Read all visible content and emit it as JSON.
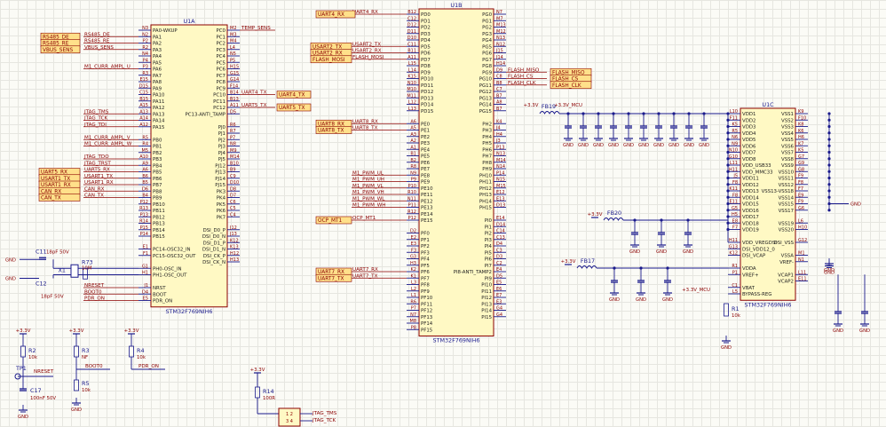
{
  "sheet": {
    "accent": "#1a1a8c",
    "wire": "#1a1a8c",
    "body_fill": "#fff9c4",
    "label": "#8b0000",
    "port_fill": "#ffe08a"
  },
  "u1a": {
    "ref": "U1A",
    "part": "STM32F769NIH6",
    "left": [
      [
        "PA0-WKUP",
        "N3"
      ],
      [
        "PA1",
        "N2"
      ],
      [
        "PA2",
        "P2"
      ],
      [
        "PA3",
        "R2"
      ],
      [
        "PA4",
        "N4"
      ],
      [
        "PA5",
        "P4"
      ],
      [
        "PA6",
        "P3"
      ],
      [
        "PA7",
        "R3"
      ],
      [
        "PA8",
        "E15"
      ],
      [
        "PA9",
        "D15"
      ],
      [
        "PA10",
        "C15"
      ],
      [
        "PA11",
        "B15"
      ],
      [
        "PA12",
        "A15"
      ],
      [
        "PA13",
        "A13"
      ],
      [
        "PA14",
        "A14"
      ],
      [
        "PA15",
        "A12"
      ],
      [
        "PB0",
        "R5"
      ],
      [
        "PB1",
        "R4"
      ],
      [
        "PB2",
        "M5"
      ],
      [
        "PB3",
        "A10"
      ],
      [
        "PB4",
        "A9"
      ],
      [
        "PB5",
        "A6"
      ],
      [
        "PB6",
        "B6"
      ],
      [
        "PB7",
        "B5"
      ],
      [
        "PB8",
        "D6"
      ],
      [
        "PB9",
        "B4"
      ],
      [
        "PB10",
        "P12"
      ],
      [
        "PB11",
        "R13"
      ],
      [
        "PB12",
        "P13"
      ],
      [
        "PB13",
        "R14"
      ],
      [
        "PB14",
        "P15"
      ],
      [
        "PB15",
        "P14"
      ],
      [
        "PC14-OSC32_IN",
        "E1"
      ],
      [
        "PC15-OSC32_OUT",
        "F1"
      ],
      [
        "PH0-OSC_IN",
        "G1"
      ],
      [
        "PH1-OSC_OUT",
        "H1"
      ],
      [
        "NRST",
        "J1"
      ],
      [
        "BOOT",
        "D4"
      ],
      [
        "PDR_ON",
        "E5"
      ]
    ],
    "right": [
      [
        "PC0",
        "M2"
      ],
      [
        "PC1",
        "M3"
      ],
      [
        "PC2",
        "M4"
      ],
      [
        "PC3",
        "L4"
      ],
      [
        "PC4",
        "N5"
      ],
      [
        "PC5",
        "P5"
      ],
      [
        "PC6",
        "H15"
      ],
      [
        "PC7",
        "G15"
      ],
      [
        "PC8",
        "G14"
      ],
      [
        "PC9",
        "F14"
      ],
      [
        "PC10",
        "B14"
      ],
      [
        "PC11",
        "B13"
      ],
      [
        "PC12",
        "A11"
      ],
      [
        "PC13-ANTI_TAMP",
        "D5"
      ],
      [
        "PJ0",
        "R6"
      ],
      [
        "PJ1",
        "R7"
      ],
      [
        "PJ2",
        "P7"
      ],
      [
        "PJ3",
        "N8"
      ],
      [
        "PJ4",
        "M9"
      ],
      [
        "PJ5",
        "M14"
      ],
      [
        "PJ12",
        "B10"
      ],
      [
        "PJ13",
        "B9"
      ],
      [
        "PJ14",
        "C9"
      ],
      [
        "PJ15",
        "D10"
      ],
      [
        "PK3",
        "D8"
      ],
      [
        "PK4",
        "D7"
      ],
      [
        "PK5",
        "C6"
      ],
      [
        "PK6",
        "C5"
      ],
      [
        "PK7",
        "C4"
      ],
      [
        "DSI_D0_P",
        "J12"
      ],
      [
        "DSI_D0_N",
        "J13"
      ],
      [
        "DSI_D1_P",
        "K12"
      ],
      [
        "DSI_D1_N",
        "K13"
      ],
      [
        "DSI_CK_P",
        "H12"
      ],
      [
        "DSI_CK_N",
        "H13"
      ]
    ],
    "nets_left": [
      [
        "RS485_DE",
        "PA1"
      ],
      [
        "RS485_RE",
        "PA2"
      ],
      [
        "VBUS_SENS",
        "PA3"
      ],
      [
        "M1_CURR_AMPL_U",
        "PA6"
      ],
      [
        "JTAG_TMS",
        "PA13"
      ],
      [
        "JTAG_TCK",
        "PA14"
      ],
      [
        "JTAG_TDI",
        "PA15"
      ],
      [
        "M1_CURR_AMPL_V",
        "PB0"
      ],
      [
        "M1_CURR_AMPL_W",
        "PB1"
      ],
      [
        "JTAG_TDO",
        "PB3"
      ],
      [
        "JTAG_TRST",
        "PB4"
      ],
      [
        "UART5_RX",
        "PB5"
      ],
      [
        "USART1_TX",
        "PB6"
      ],
      [
        "USART1_RX",
        "PB7"
      ],
      [
        "CAN_RX",
        "PB8"
      ],
      [
        "CAN_TX",
        "PB9"
      ],
      [
        "NRESET",
        "NRST"
      ],
      [
        "BOOT0",
        "BOOT"
      ],
      [
        "PDR_ON",
        "PDR_ON"
      ]
    ],
    "nets_right": [
      [
        "TEMP_SENS",
        "PC0"
      ],
      [
        "UART4_TX",
        "PC10"
      ],
      [
        "UART5_TX",
        "PC12"
      ]
    ]
  },
  "u1b": {
    "ref": "U1B",
    "part": "STM32F769NIH6",
    "left": [
      [
        "PD0",
        "B12"
      ],
      [
        "PD1",
        "C12"
      ],
      [
        "PD2",
        "D12"
      ],
      [
        "PD3",
        "D11"
      ],
      [
        "PD4",
        "D10"
      ],
      [
        "PD5",
        "C11"
      ],
      [
        "PD6",
        "B11"
      ],
      [
        "PD7",
        "A11"
      ],
      [
        "PD8",
        "L15"
      ],
      [
        "PD9",
        "L14"
      ],
      [
        "PD10",
        "K15"
      ],
      [
        "PD11",
        "N10"
      ],
      [
        "PD12",
        "M10"
      ],
      [
        "PD13",
        "M11"
      ],
      [
        "PD14",
        "L12"
      ],
      [
        "PD15",
        "L13"
      ],
      [
        "PE0",
        "A6"
      ],
      [
        "PE1",
        "A5"
      ],
      [
        "PE2",
        "A3"
      ],
      [
        "PE3",
        "A2"
      ],
      [
        "PE4",
        "A1"
      ],
      [
        "PE5",
        "B1"
      ],
      [
        "PE6",
        "B2"
      ],
      [
        "PE7",
        "R8"
      ],
      [
        "PE8",
        "N9"
      ],
      [
        "PE9",
        "P9"
      ],
      [
        "PE10",
        "P10"
      ],
      [
        "PE11",
        "R10"
      ],
      [
        "PE12",
        "N11"
      ],
      [
        "PE13",
        "P11"
      ],
      [
        "PE14",
        "R12"
      ],
      [
        "PE15",
        "P12"
      ],
      [
        "PF0",
        "D2"
      ],
      [
        "PF1",
        "E2"
      ],
      [
        "PF2",
        "E3"
      ],
      [
        "PF3",
        "F3"
      ],
      [
        "PF4",
        "G3"
      ],
      [
        "PF5",
        "H3"
      ],
      [
        "PF6",
        "K2"
      ],
      [
        "PF7",
        "K1"
      ],
      [
        "PF8",
        "L3"
      ],
      [
        "PF9",
        "L2"
      ],
      [
        "PF10",
        "L1"
      ],
      [
        "PF11",
        "R6"
      ],
      [
        "PF12",
        "P7"
      ],
      [
        "PF13",
        "N7"
      ],
      [
        "PF14",
        "M8"
      ],
      [
        "PF15",
        "P8"
      ]
    ],
    "right": [
      [
        "PG0",
        "N7"
      ],
      [
        "PG1",
        "M7"
      ],
      [
        "PG2",
        "M13"
      ],
      [
        "PG3",
        "M12"
      ],
      [
        "PG4",
        "N13"
      ],
      [
        "PG5",
        "N12"
      ],
      [
        "PG6",
        "J15"
      ],
      [
        "PG7",
        "J14"
      ],
      [
        "PG8",
        "H14"
      ],
      [
        "PG9",
        "D9"
      ],
      [
        "PG10",
        "C8"
      ],
      [
        "PG11",
        "B8"
      ],
      [
        "PG12",
        "C7"
      ],
      [
        "PG13",
        "B7"
      ],
      [
        "PG14",
        "A8"
      ],
      [
        "PG15",
        "B7"
      ],
      [
        "PH2",
        "K4"
      ],
      [
        "PH3",
        "J4"
      ],
      [
        "PH4",
        "H4"
      ],
      [
        "PH5",
        "J3"
      ],
      [
        "PH6",
        "P13"
      ],
      [
        "PH7",
        "N13"
      ],
      [
        "PH8",
        "M14"
      ],
      [
        "PH9",
        "N14"
      ],
      [
        "PH10",
        "P14"
      ],
      [
        "PH11",
        "N15"
      ],
      [
        "PH12",
        "M15"
      ],
      [
        "PH13",
        "E12"
      ],
      [
        "PH14",
        "E13"
      ],
      [
        "PH15",
        "D13"
      ],
      [
        "PI0",
        "E14"
      ],
      [
        "PI1",
        "D14"
      ],
      [
        "PI2",
        "C14"
      ],
      [
        "PI3",
        "C13"
      ],
      [
        "PI4",
        "D4"
      ],
      [
        "PI5",
        "C3"
      ],
      [
        "PI6",
        "D3"
      ],
      [
        "PI7",
        "C2"
      ],
      [
        "PI8-ANTI_TAMP2",
        "E4"
      ],
      [
        "PI9",
        "D5"
      ],
      [
        "PI10",
        "E5"
      ],
      [
        "PI11",
        "E6"
      ],
      [
        "PI12",
        "E7"
      ],
      [
        "PI13",
        "E3"
      ],
      [
        "PI14",
        "G4"
      ],
      [
        "PI15",
        "G4"
      ]
    ],
    "nets_left": [
      [
        "UART4_RX",
        "PD0"
      ],
      [
        "USART2_TX",
        "PD5"
      ],
      [
        "USART2_RX",
        "PD6"
      ],
      [
        "FLASH_MOSI",
        "PD7"
      ],
      [
        "UART8_RX",
        "PE0"
      ],
      [
        "UART8_TX",
        "PE1"
      ],
      [
        "M1_PWM_UL",
        "PE8"
      ],
      [
        "M1_PWM_UH",
        "PE9"
      ],
      [
        "M1_PWM_VL",
        "PE10"
      ],
      [
        "M1_PWM_VH",
        "PE11"
      ],
      [
        "M1_PWM_WL",
        "PE12"
      ],
      [
        "M1_PWM_WH",
        "PE13"
      ],
      [
        "OCP_MT1",
        "PE15"
      ],
      [
        "UART7_RX",
        "PF6"
      ],
      [
        "UART7_TX",
        "PF7"
      ]
    ],
    "nets_right": [
      [
        "FLASH_MISO",
        "PG9"
      ],
      [
        "FLASH_CS",
        "PG10"
      ],
      [
        "FLASH_CLK",
        "PG11"
      ]
    ]
  },
  "u1c": {
    "ref": "U1C",
    "part": "STM32F769NIH6",
    "left": [
      [
        "VDD1",
        "L10"
      ],
      [
        "VDD2",
        "F11"
      ],
      [
        "VDD3",
        "K5"
      ],
      [
        "VDD4",
        "R5"
      ],
      [
        "VDD5",
        "N6"
      ],
      [
        "VDD6",
        "N9"
      ],
      [
        "VDD7",
        "N10"
      ],
      [
        "VDD8",
        "G10"
      ],
      [
        "VDD_USB33",
        "L11"
      ],
      [
        "VDD_MMC33",
        "H11"
      ],
      [
        "VDD11",
        "J5"
      ],
      [
        "VDD12",
        "F8"
      ],
      [
        "VDD13",
        "K11"
      ],
      [
        "VDD14",
        "F8"
      ],
      [
        "VDD15",
        "E11"
      ],
      [
        "VDD16",
        "G5"
      ],
      [
        "VDD17",
        "H5"
      ],
      [
        "VDD18",
        "E8"
      ],
      [
        "VDD19",
        "F7"
      ],
      [
        "VDD_VREGDSI",
        "H11"
      ],
      [
        "DSI_VDD12_0",
        "G13"
      ],
      [
        "DSI_VCAP",
        "K12"
      ],
      [
        "VDDA",
        "R1"
      ],
      [
        "VREF+",
        "P1"
      ],
      [
        "VBAT",
        "C1"
      ],
      [
        "BYPASS-REG",
        "L5"
      ]
    ],
    "right": [
      [
        "VSS1",
        "K9"
      ],
      [
        "VSS2",
        "F10"
      ],
      [
        "VSS3",
        "K8"
      ],
      [
        "VSS4",
        "K6"
      ],
      [
        "VSS5",
        "H6"
      ],
      [
        "VSS6",
        "K7"
      ],
      [
        "VSS7",
        "K5"
      ],
      [
        "VSS8",
        "G7"
      ],
      [
        "VSS9",
        "G9"
      ],
      [
        "VSS10",
        "G8"
      ],
      [
        "VSS11",
        "F9"
      ],
      [
        "VSS12",
        "F8"
      ],
      [
        "VSS13-VSS18",
        "F7"
      ],
      [
        "VSS14",
        "E9"
      ],
      [
        "VSS15",
        "F9"
      ],
      [
        "VSS17",
        "G6"
      ],
      [
        "VSS19",
        "L6"
      ],
      [
        "VSS20",
        "H10"
      ],
      [
        "DSI_VSS",
        "G12"
      ],
      [
        "VSSA",
        "M1"
      ],
      [
        "VREF-",
        "N1"
      ],
      [
        "VCAP1",
        "L11"
      ],
      [
        "VCAP2",
        "E11"
      ]
    ]
  },
  "passives": {
    "C11": "C11",
    "C11v": "18pF 50V",
    "C12": "C12",
    "C12v": "18pF 50V",
    "R73": "R73",
    "R73v": "10M",
    "X1": "X1",
    "R2": "R2",
    "R2v": "10k",
    "R3": "R3",
    "R3v": "NF",
    "R4": "R4",
    "R4v": "10k",
    "R5": "R5",
    "R5v": "10k",
    "C17": "C17",
    "C17v": "100nF 50V",
    "TP1": "TP1",
    "R14": "R14",
    "R14v": "100R",
    "R1": "R1",
    "R1v": "10k",
    "FB19": "FB19",
    "FB20": "FB20",
    "FB17": "FB17",
    "J": "1 2",
    "J2": "3 4"
  },
  "power": {
    "v33": "+3.3V",
    "v33mcu": "+3.3V_MCU",
    "gnd": "GND"
  },
  "bottom_nets": {
    "nreset": "NRESET",
    "boot0": "BOOT0",
    "pdr": "PDR_ON",
    "jtms": "JTAG_TMS",
    "jtck": "JTAG_TCK",
    "jtdo": "JTAG_TDO"
  }
}
